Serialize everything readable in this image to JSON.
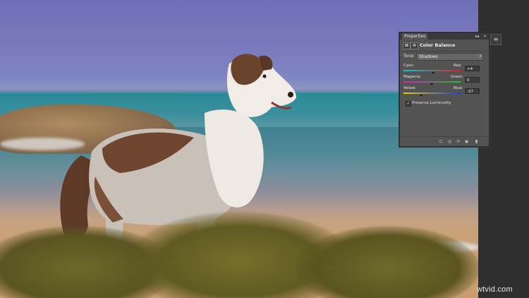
{
  "panel": {
    "tab_label": "Properties",
    "title": "Color Balance",
    "tone_label": "Tone:",
    "tone_value": "Shadows",
    "sliders": [
      {
        "left": "Cyan",
        "right": "Red",
        "value": "+4",
        "position": 0.52,
        "gradient": [
          "#00c8d8",
          "#e02020"
        ]
      },
      {
        "left": "Magenta",
        "right": "Green",
        "value": "0",
        "position": 0.5,
        "gradient": [
          "#d020c8",
          "#20c020"
        ]
      },
      {
        "left": "Yellow",
        "right": "Blue",
        "value": "-37",
        "position": 0.32,
        "gradient": [
          "#e0d000",
          "#2040e0"
        ]
      }
    ],
    "preserve_luminosity": "Preserve Luminosity",
    "preserve_checked": true,
    "controls": {
      "collapse": "▸▸",
      "close": "×",
      "menu": "≡"
    }
  },
  "footer_icons": [
    "clip-to-layer-icon",
    "eye-visibility-icon",
    "reset-icon",
    "toggle-visibility-icon",
    "trash-icon"
  ],
  "dock_button": "≡",
  "watermark": "wtvid.com"
}
